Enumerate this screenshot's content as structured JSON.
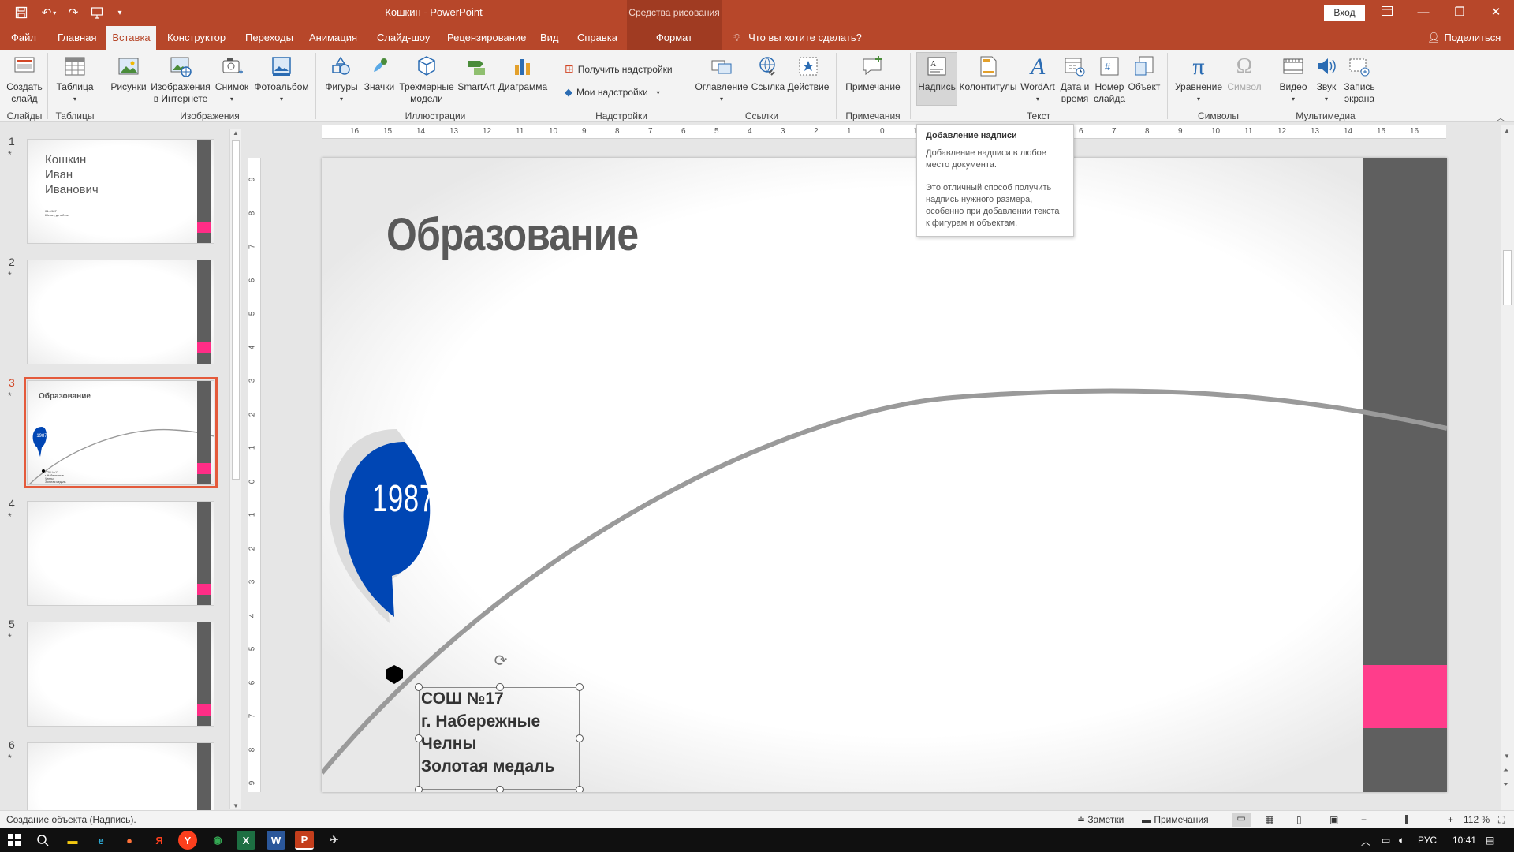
{
  "titlebar": {
    "doc_title": "Кошкин  -  PowerPoint",
    "contextual_group": "Средства рисования",
    "signin": "Вход",
    "colors": {
      "accent": "#b7472a",
      "contextual": "#a03b22"
    }
  },
  "tabs": [
    {
      "label": "Файл"
    },
    {
      "label": "Главная"
    },
    {
      "label": "Вставка"
    },
    {
      "label": "Конструктор"
    },
    {
      "label": "Переходы"
    },
    {
      "label": "Анимация"
    },
    {
      "label": "Слайд-шоу"
    },
    {
      "label": "Рецензирование"
    },
    {
      "label": "Вид"
    },
    {
      "label": "Справка"
    },
    {
      "label": "Формат"
    }
  ],
  "tell_me": "Что вы хотите сделать?",
  "share": "Поделиться",
  "ribbon": {
    "new_slide": "Создать\nслайд",
    "table": "Таблица",
    "pictures": "Рисунки",
    "online_pictures": "Изображения\nв Интернете",
    "screenshot": "Снимок",
    "photo_album": "Фотоальбом",
    "shapes": "Фигуры",
    "icons": "Значки",
    "models_3d": "Трехмерные\nмодели",
    "smartart": "SmartArt",
    "chart": "Диаграмма",
    "get_addins": "Получить надстройки",
    "my_addins": "Мои надстройки",
    "zoom": "Оглавление",
    "link": "Ссылка",
    "action": "Действие",
    "comment": "Примечание",
    "textbox": "Надпись",
    "header_footer": "Колонтитулы",
    "wordart": "WordArt",
    "date_time": "Дата и\nвремя",
    "slide_number": "Номер\nслайда",
    "object": "Объект",
    "equation": "Уравнение",
    "symbol": "Символ",
    "video": "Видео",
    "audio": "Звук",
    "screen_recording": "Запись\nэкрана",
    "groups": {
      "slides": "Слайды",
      "tables": "Таблицы",
      "images": "Изображения",
      "illustrations": "Иллюстрации",
      "addins": "Надстройки",
      "links": "Ссылки",
      "comments": "Примечания",
      "text": "Текст",
      "symbols": "Символы",
      "media": "Мультимедиа"
    }
  },
  "tooltip": {
    "title": "Добавление надписи",
    "p1": "Добавление надписи в любое место документа.",
    "p2": "Это отличный способ получить надпись нужного размера, особенно при добавлении текста к фигурам и объектам."
  },
  "thumbnails": [
    {
      "num": "1",
      "star": "*",
      "name": "Кошкин\nИван\nИванович",
      "sub": "01-1987\nЖенат, детей нет"
    },
    {
      "num": "2",
      "star": "*"
    },
    {
      "num": "3",
      "star": "*",
      "title": "Образование",
      "year": "1987",
      "caption": "СОШ №17\nг. Набережные\nЧелны\nЗолотая медаль"
    },
    {
      "num": "4",
      "star": "*"
    },
    {
      "num": "5",
      "star": "*"
    },
    {
      "num": "6",
      "star": "*"
    }
  ],
  "ruler": {
    "h_ticks": [
      "16",
      "15",
      "14",
      "13",
      "12",
      "11",
      "10",
      "9",
      "8",
      "7",
      "6",
      "5",
      "4",
      "3",
      "2",
      "1",
      "0",
      "1",
      "2",
      "3",
      "4",
      "5",
      "6",
      "7",
      "8",
      "9",
      "10",
      "11",
      "12",
      "13",
      "14",
      "15",
      "16"
    ],
    "v_ticks": [
      "9",
      "8",
      "7",
      "6",
      "5",
      "4",
      "3",
      "2",
      "1",
      "0",
      "1",
      "2",
      "3",
      "4",
      "5",
      "6",
      "7",
      "8",
      "9"
    ]
  },
  "slide": {
    "title": "Образование",
    "year": "1987",
    "textbox_lines": [
      "СОШ №17",
      "г. Набережные",
      "Челны",
      "Золотая медаль"
    ],
    "colors": {
      "title": "#595959",
      "bubble": "#0046b4",
      "bar": "#5f5f5f",
      "accent_pink": "#ff3d8b",
      "curve": "#9a9a9a"
    }
  },
  "status": {
    "left": "Создание объекта (Надпись).",
    "notes": "Заметки",
    "comments": "Примечания",
    "zoom": "112 %"
  },
  "taskbar": {
    "lang": "РУС",
    "time": "10:41"
  }
}
